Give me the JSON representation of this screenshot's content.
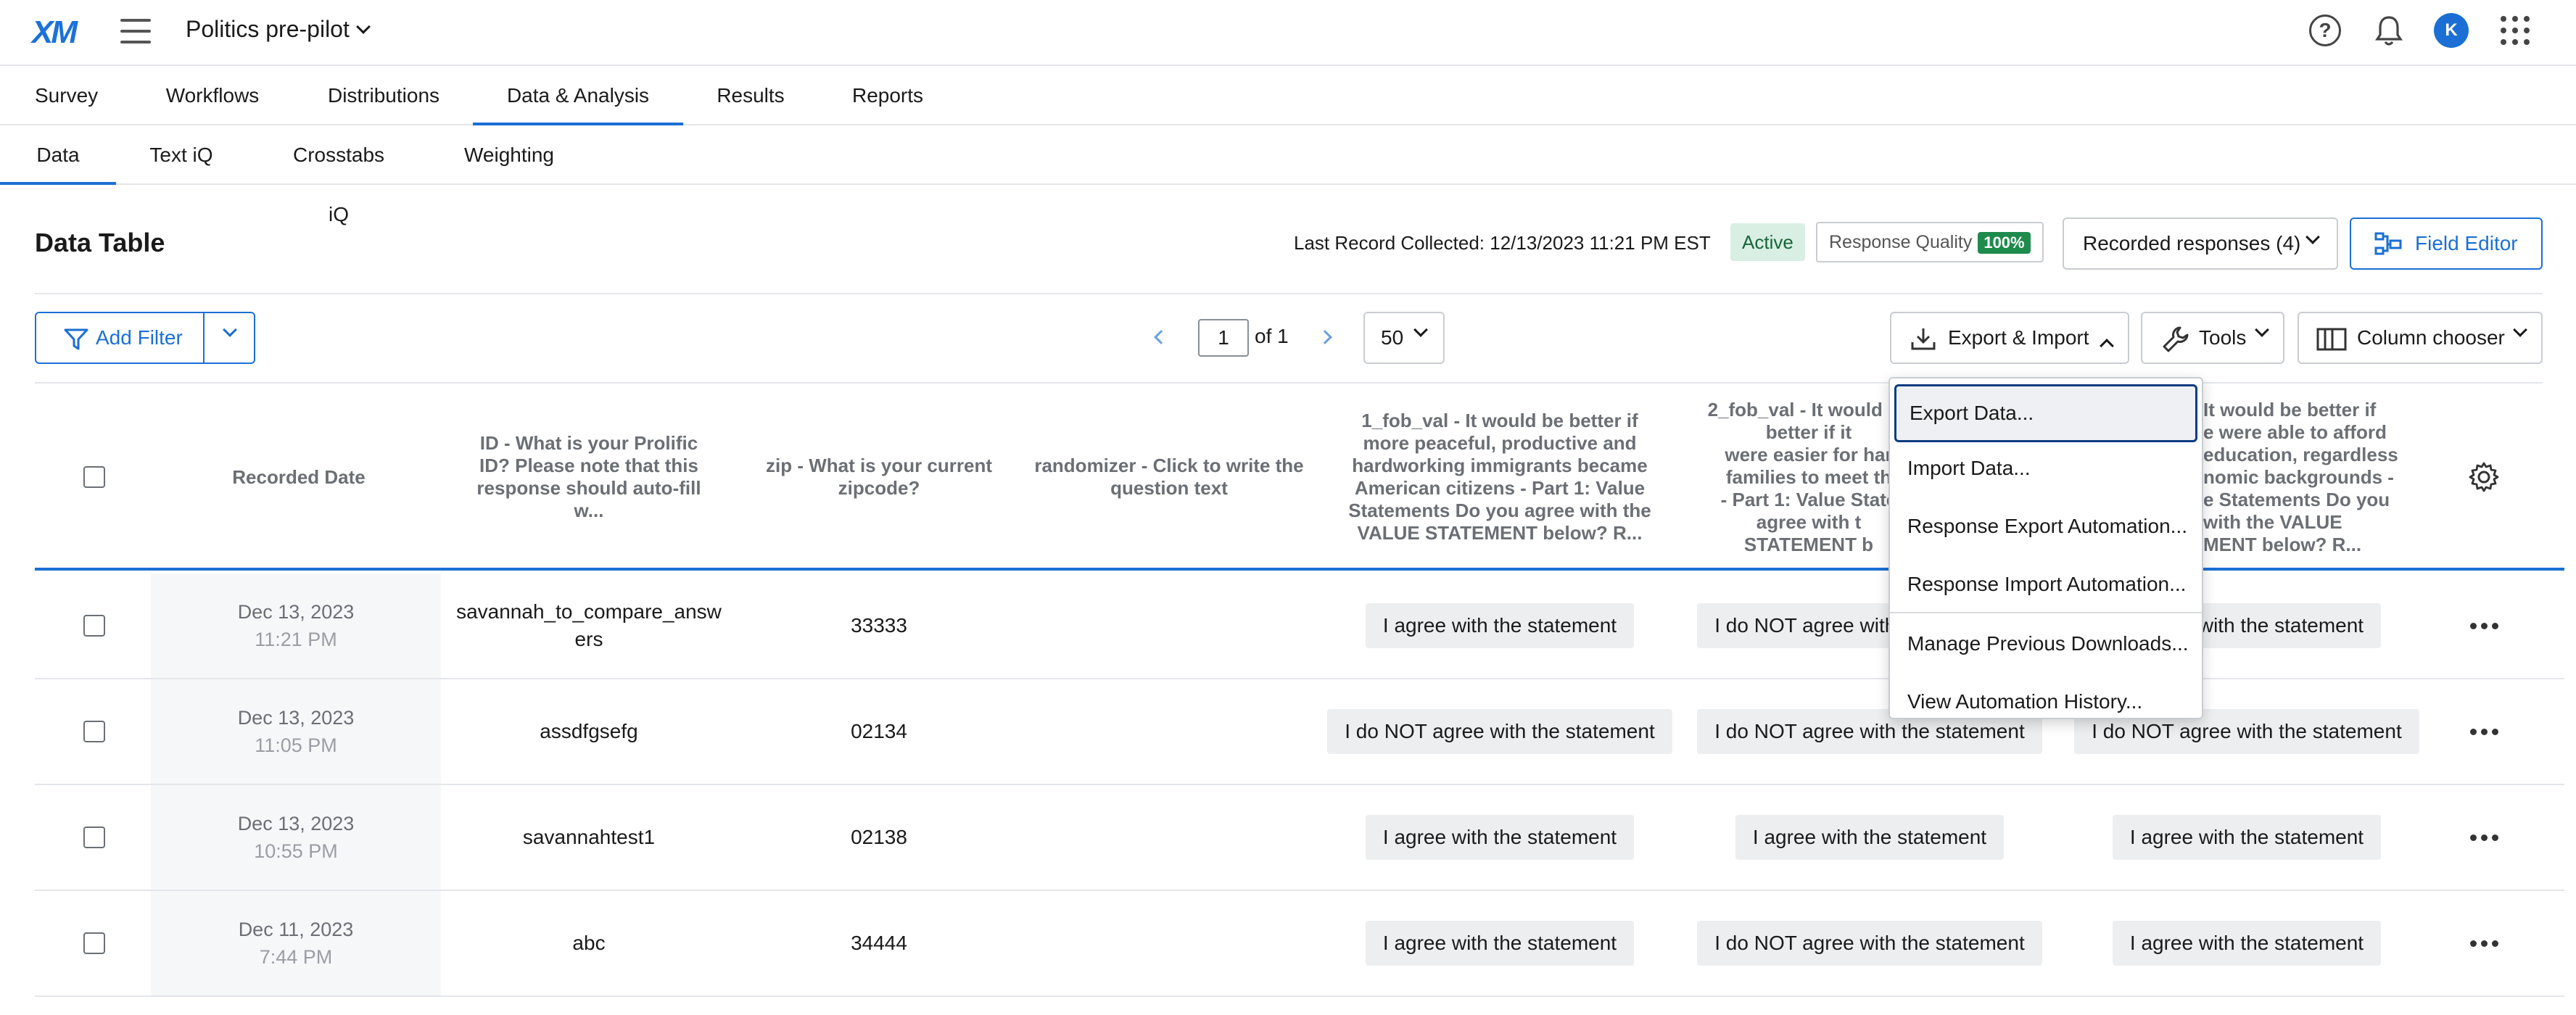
{
  "topbar": {
    "logo": "XM",
    "project": "Politics pre-pilot",
    "avatar_initial": "K"
  },
  "main_nav": {
    "tabs": [
      {
        "label": "Survey"
      },
      {
        "label": "Workflows"
      },
      {
        "label": "Distributions"
      },
      {
        "label": "Data & Analysis",
        "active": true
      },
      {
        "label": "Results"
      },
      {
        "label": "Reports"
      }
    ]
  },
  "sub_nav": {
    "tabs": [
      {
        "label": "Data",
        "active": true
      },
      {
        "label": "Text iQ"
      },
      {
        "label": "Crosstabs iQ"
      },
      {
        "label": "Weighting"
      }
    ]
  },
  "header": {
    "title": "Data Table",
    "last_record": "Last Record Collected: 12/13/2023 11:21 PM EST",
    "status": "Active",
    "response_quality_label": "Response Quality",
    "response_quality_value": "100%",
    "recorded_responses": "Recorded responses (4)",
    "field_editor": "Field Editor"
  },
  "toolbar": {
    "add_filter": "Add Filter",
    "page_value": "1",
    "page_of": "of 1",
    "page_size": "50",
    "export_import": "Export & Import",
    "tools": "Tools",
    "column_chooser": "Column chooser"
  },
  "table": {
    "columns": [
      "Recorded Date",
      "ID - What is your Prolific ID? Please note that this response should auto-fill w...",
      "zip - What is your current zipcode?",
      "randomizer - Click to write the question text",
      "1_fob_val - It would be better if more peaceful, productive and hardworking immigrants became American citizens - Part 1: Value Statements Do you agree with the VALUE STATEMENT below? R...",
      "2_fob_val - It would be better if it were easier for hardworking families to meet the... - Part 1: Value Statements Do you agree with the VALUE STATEMENT below? R...",
      "3_fob_val - It would be better if people were able to afford a good education, regardless of economic backgrounds - Part 1: Value Statements Do you agree with the VALUE STATEMENT below? R..."
    ],
    "column_visible_text": {
      "col6": "2_fob_val - It would be better if it\nwere easier for har\nfamilies to meet th\n- Part 1: Value State\nagree with t\nSTATEMENT b",
      "col7": "It would be better if\ne were able to afford\neducation, regardless\nnomic backgrounds -\ne Statements Do you\nwith the VALUE\nMENT below? R..."
    },
    "rows": [
      {
        "date": "Dec 13, 2023",
        "time": "11:21 PM",
        "id": "savannah_to_compare_answers",
        "zip": "33333",
        "randomizer": "",
        "v1": "I agree with the statement",
        "v2": "I do NOT agree with the statement",
        "v3": "I agree with the statement"
      },
      {
        "date": "Dec 13, 2023",
        "time": "11:05 PM",
        "id": "assdfgsefg",
        "zip": "02134",
        "randomizer": "",
        "v1": "I do NOT agree with the statement",
        "v2": "I do NOT agree with the statement",
        "v3": "I do NOT agree with the statement"
      },
      {
        "date": "Dec 13, 2023",
        "time": "10:55 PM",
        "id": "savannahtest1",
        "zip": "02138",
        "randomizer": "",
        "v1": "I agree with the statement",
        "v2": "I agree with the statement",
        "v3": "I agree with the statement"
      },
      {
        "date": "Dec 11, 2023",
        "time": "7:44 PM",
        "id": "abc",
        "zip": "34444",
        "randomizer": "",
        "v1": "I agree with the statement",
        "v2": "I do NOT agree with the statement",
        "v3": "I agree with the statement"
      }
    ]
  },
  "export_menu": {
    "items": [
      {
        "label": "Export Data..."
      },
      {
        "label": "Import Data..."
      },
      {
        "label": "Response Export Automation..."
      },
      {
        "label": "Response Import Automation..."
      },
      {
        "label": "Manage Previous Downloads..."
      },
      {
        "label": "View Automation History..."
      }
    ]
  },
  "colors": {
    "accent": "#1b6fd4",
    "active_badge_bg": "#d9efe3",
    "quality_badge": "#1e8a4c",
    "focused_outline": "#0b3c80"
  },
  "icons": [
    "hamburger-icon",
    "help-icon",
    "bell-icon",
    "apps-icon",
    "field-editor-icon",
    "filter-icon",
    "download-icon",
    "wrench-icon",
    "columns-icon",
    "gear-icon",
    "more-options-icon"
  ]
}
